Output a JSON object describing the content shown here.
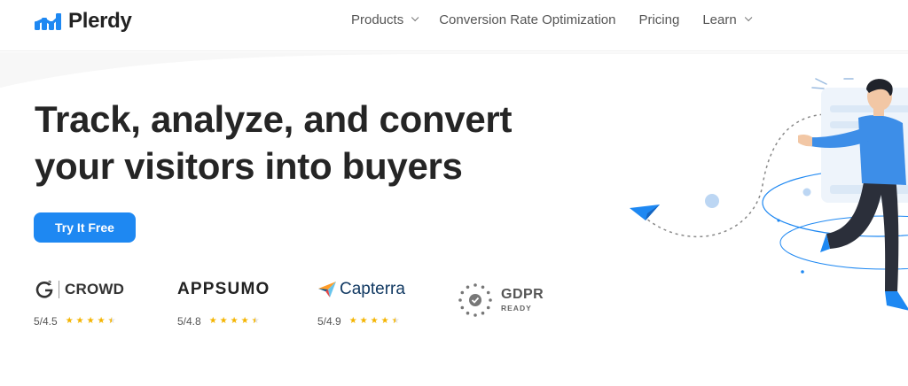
{
  "brand": {
    "name": "Plerdy",
    "accent": "#1e88f2"
  },
  "nav": [
    {
      "label": "Products",
      "has_dropdown": true
    },
    {
      "label": "Conversion Rate Optimization",
      "has_dropdown": false
    },
    {
      "label": "Pricing",
      "has_dropdown": false
    },
    {
      "label": "Learn",
      "has_dropdown": true
    }
  ],
  "hero": {
    "headline_line1": "Track, analyze, and convert",
    "headline_line2": "your visitors into buyers",
    "cta_label": "Try It Free"
  },
  "ratings": [
    {
      "brand": "CROWD",
      "brand_prefix": "G",
      "brand_prefix_sup": "2",
      "score": "5/4.5",
      "stars": 4.5
    },
    {
      "brand": "APPSUMO",
      "score": "5/4.8",
      "stars": 4.5
    },
    {
      "brand": "Capterra",
      "score": "5/4.9",
      "stars": 4.5
    }
  ],
  "gdpr": {
    "title": "GDPR",
    "subtitle": "READY"
  },
  "icons": {
    "logo": "bar-chart-logo-icon",
    "g2": "g2-logo-icon",
    "capterra": "capterra-arrow-icon",
    "gdpr": "gdpr-stars-check-icon",
    "dropdown": "chevron-down-icon",
    "paper_plane": "paper-plane-icon"
  }
}
